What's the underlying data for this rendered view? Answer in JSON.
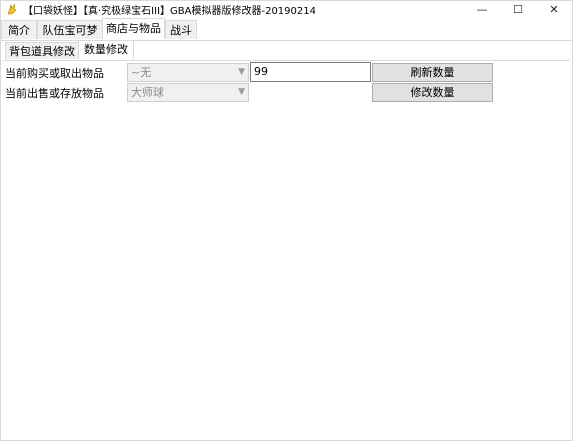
{
  "window": {
    "title": "【口袋妖怪】【真·究极绿宝石III】GBA模拟器版修改器-20190214",
    "controls": {
      "minimize": "—",
      "maximize": "☐",
      "close": "✕"
    }
  },
  "main_tabs": [
    "简介",
    "队伍宝可梦",
    "商店与物品",
    "战斗"
  ],
  "main_tab_active": "商店与物品",
  "sub_tabs": [
    "背包道具修改",
    "数量修改"
  ],
  "sub_tab_active": "数量修改",
  "form": {
    "row1": {
      "label": "当前购买或取出物品",
      "select_value": "~无",
      "quantity_value": "99",
      "button": "刷新数量"
    },
    "row2": {
      "label": "当前出售或存放物品",
      "select_value": "大师球",
      "button": "修改数量"
    }
  },
  "icons": {
    "app": "pokemon-app-icon",
    "select_arrow": "chevron-down-icon"
  }
}
